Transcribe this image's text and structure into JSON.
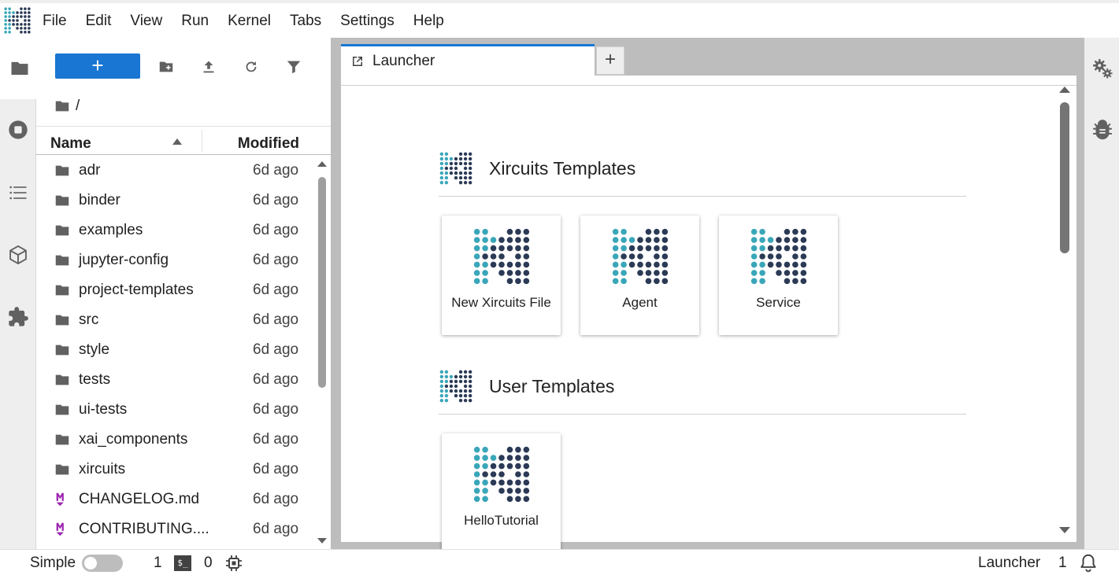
{
  "menubar": {
    "logo_icon": "xircuits-logo-icon",
    "items": [
      "File",
      "Edit",
      "View",
      "Run",
      "Kernel",
      "Tabs",
      "Settings",
      "Help"
    ]
  },
  "left_sidebar": {
    "tabs": [
      {
        "icon": "folder-icon",
        "active": true
      },
      {
        "icon": "running-stop-icon",
        "active": false
      },
      {
        "icon": "table-of-contents-icon",
        "active": false
      },
      {
        "icon": "cube-icon",
        "active": false
      },
      {
        "icon": "puzzle-extension-icon",
        "active": false
      }
    ]
  },
  "file_browser": {
    "new_button_label": "+",
    "breadcrumb": "/",
    "columns": {
      "name": "Name",
      "modified": "Modified"
    },
    "files": [
      {
        "name": "adr",
        "modified": "6d ago",
        "type": "folder"
      },
      {
        "name": "binder",
        "modified": "6d ago",
        "type": "folder"
      },
      {
        "name": "examples",
        "modified": "6d ago",
        "type": "folder"
      },
      {
        "name": "jupyter-config",
        "modified": "6d ago",
        "type": "folder"
      },
      {
        "name": "project-templates",
        "modified": "6d ago",
        "type": "folder"
      },
      {
        "name": "src",
        "modified": "6d ago",
        "type": "folder"
      },
      {
        "name": "style",
        "modified": "6d ago",
        "type": "folder"
      },
      {
        "name": "tests",
        "modified": "6d ago",
        "type": "folder"
      },
      {
        "name": "ui-tests",
        "modified": "6d ago",
        "type": "folder"
      },
      {
        "name": "xai_components",
        "modified": "6d ago",
        "type": "folder"
      },
      {
        "name": "xircuits",
        "modified": "6d ago",
        "type": "folder"
      },
      {
        "name": "CHANGELOG.md",
        "modified": "6d ago",
        "type": "markdown"
      },
      {
        "name": "CONTRIBUTING....",
        "modified": "6d ago",
        "type": "markdown"
      }
    ]
  },
  "tabs": {
    "active_tab_label": "Launcher",
    "add_tab_label": "+"
  },
  "launcher": {
    "sections": [
      {
        "title": "Xircuits Templates",
        "cards": [
          "New Xircuits File",
          "Agent",
          "Service"
        ]
      },
      {
        "title": "User Templates",
        "cards": [
          "HelloTutorial"
        ]
      }
    ]
  },
  "right_sidebar": {
    "tabs": [
      "property-inspector-gears-icon",
      "debugger-bug-icon"
    ]
  },
  "statusbar": {
    "mode_label": "Simple",
    "simple_mode_on": false,
    "kernels_count": "1",
    "terminal_icon_label": "$_",
    "terminals_count": "0",
    "active_item": "Launcher",
    "notifications_count": "1"
  },
  "colors": {
    "accent": "#1976d2",
    "logo_teal": "#3aa6b9",
    "logo_navy": "#2b3a55",
    "markdown_purple": "#9c27b0"
  }
}
